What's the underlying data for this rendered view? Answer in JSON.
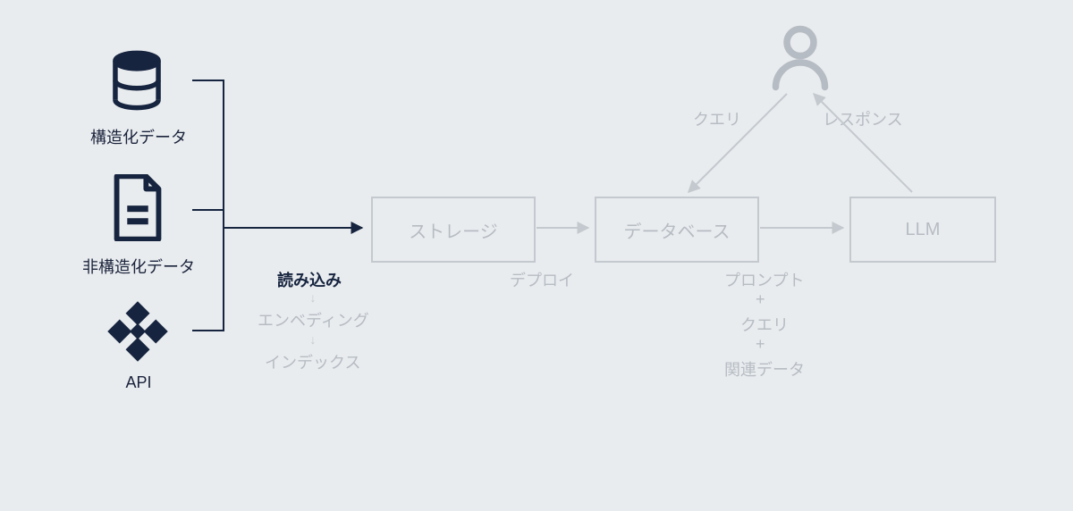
{
  "sources": {
    "structured_label": "構造化データ",
    "unstructured_label": "非構造化データ",
    "api_label": "API"
  },
  "pipeline": {
    "storage_label": "ストレージ",
    "database_label": "データベース",
    "llm_label": "LLM",
    "load_label": "読み込み",
    "embedding_label": "エンベディング",
    "index_label": "インデックス",
    "deploy_label": "デプロイ",
    "prompt_label": "プロンプト",
    "plus1": "+",
    "query2_label": "クエリ",
    "plus2": "+",
    "related_label": "関連データ"
  },
  "user": {
    "query_label": "クエリ",
    "response_label": "レスポンス"
  },
  "colors": {
    "active": "#16243f",
    "faded": "#b6bcc3",
    "faded_stroke": "#c3c9ce"
  }
}
